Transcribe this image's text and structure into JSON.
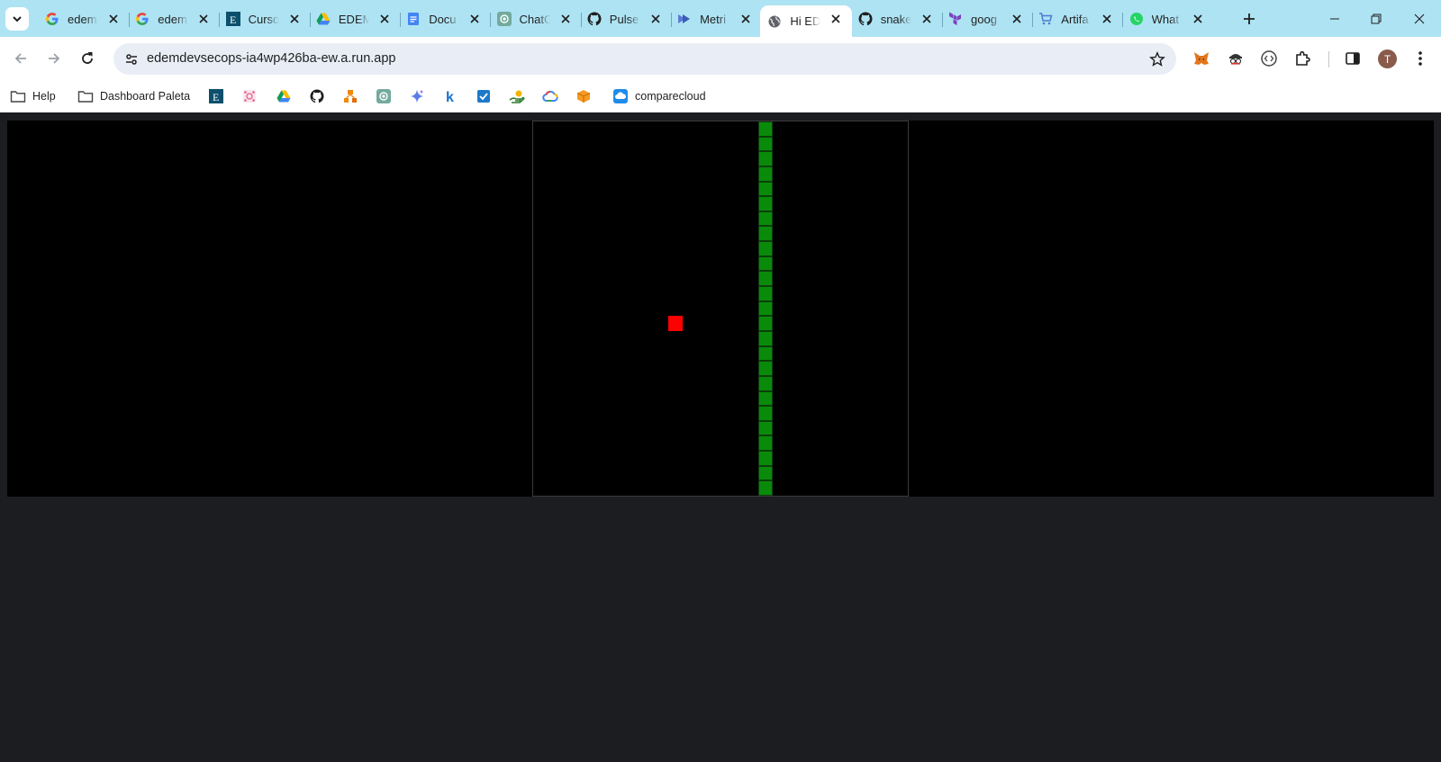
{
  "tabs": [
    {
      "title": "edem",
      "icon": "google-icon",
      "active": false
    },
    {
      "title": "edem",
      "icon": "google-icon",
      "active": false
    },
    {
      "title": "Curso",
      "icon": "edem-icon",
      "active": false
    },
    {
      "title": "EDEM",
      "icon": "google-drive-icon",
      "active": false
    },
    {
      "title": "Docu",
      "icon": "google-docs-icon",
      "active": false
    },
    {
      "title": "ChatG",
      "icon": "chatgpt-icon",
      "active": false
    },
    {
      "title": "Pulse",
      "icon": "github-icon",
      "active": false
    },
    {
      "title": "Metri",
      "icon": "metrics-icon",
      "active": false
    },
    {
      "title": "Hi ED",
      "icon": "globe-icon",
      "active": true
    },
    {
      "title": "snake",
      "icon": "github-icon",
      "active": false
    },
    {
      "title": "goog",
      "icon": "terraform-icon",
      "active": false
    },
    {
      "title": "Artifa",
      "icon": "artifact-registry-icon",
      "active": false
    },
    {
      "title": "What",
      "icon": "whatsapp-icon",
      "active": false
    }
  ],
  "omnibox": {
    "url": "edemdevsecops-ia4wp426ba-ew.a.run.app"
  },
  "profile": {
    "initial": "T"
  },
  "bookmarks": [
    {
      "label": "Help",
      "icon": "folder-icon"
    },
    {
      "label": "Dashboard Paleta",
      "icon": "folder-icon"
    },
    {
      "label": "",
      "icon": "edem-icon"
    },
    {
      "label": "",
      "icon": "mindmap-icon"
    },
    {
      "label": "",
      "icon": "google-drive-icon"
    },
    {
      "label": "",
      "icon": "github-icon"
    },
    {
      "label": "",
      "icon": "diagram-icon"
    },
    {
      "label": "",
      "icon": "chatgpt-icon"
    },
    {
      "label": "",
      "icon": "gemini-icon"
    },
    {
      "label": "",
      "icon": "k-icon"
    },
    {
      "label": "",
      "icon": "checkbox-icon"
    },
    {
      "label": "",
      "icon": "hand-money-icon"
    },
    {
      "label": "",
      "icon": "google-cloud-icon"
    },
    {
      "label": "",
      "icon": "cube-icon"
    },
    {
      "label": "comparecloud",
      "icon": "comparecloud-icon"
    }
  ],
  "game": {
    "grid_columns": 25,
    "grid_rows": 25,
    "snake_color": "#0a8a0a",
    "food_color": "#ff0000",
    "snake": {
      "column": 15,
      "row_start": 0,
      "row_end": 24
    },
    "food": {
      "column": 9,
      "row": 13
    }
  },
  "colors": {
    "tabstrip": "#aee3f3",
    "page_background": "#1c1d20",
    "canvas": "#000000"
  }
}
